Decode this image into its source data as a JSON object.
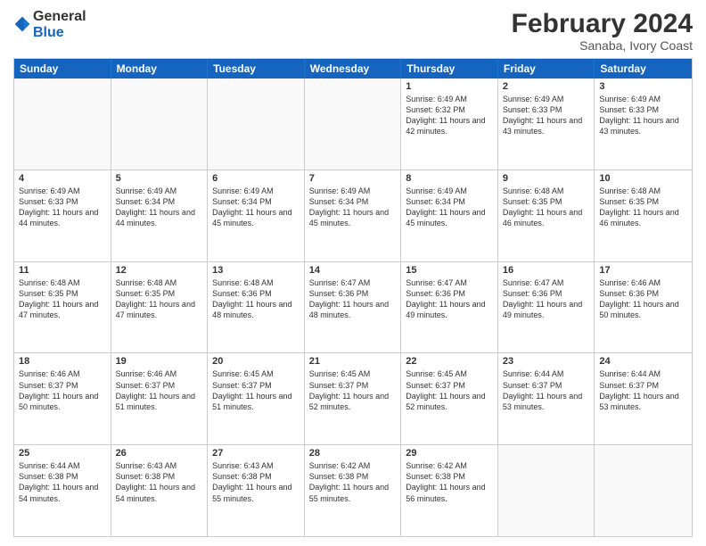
{
  "logo": {
    "general": "General",
    "blue": "Blue"
  },
  "header": {
    "month": "February 2024",
    "location": "Sanaba, Ivory Coast"
  },
  "days": [
    "Sunday",
    "Monday",
    "Tuesday",
    "Wednesday",
    "Thursday",
    "Friday",
    "Saturday"
  ],
  "weeks": [
    [
      {
        "num": "",
        "sunrise": "",
        "sunset": "",
        "daylight": "",
        "empty": true
      },
      {
        "num": "",
        "sunrise": "",
        "sunset": "",
        "daylight": "",
        "empty": true
      },
      {
        "num": "",
        "sunrise": "",
        "sunset": "",
        "daylight": "",
        "empty": true
      },
      {
        "num": "",
        "sunrise": "",
        "sunset": "",
        "daylight": "",
        "empty": true
      },
      {
        "num": "1",
        "sunrise": "Sunrise: 6:49 AM",
        "sunset": "Sunset: 6:32 PM",
        "daylight": "Daylight: 11 hours and 42 minutes.",
        "empty": false
      },
      {
        "num": "2",
        "sunrise": "Sunrise: 6:49 AM",
        "sunset": "Sunset: 6:33 PM",
        "daylight": "Daylight: 11 hours and 43 minutes.",
        "empty": false
      },
      {
        "num": "3",
        "sunrise": "Sunrise: 6:49 AM",
        "sunset": "Sunset: 6:33 PM",
        "daylight": "Daylight: 11 hours and 43 minutes.",
        "empty": false
      }
    ],
    [
      {
        "num": "4",
        "sunrise": "Sunrise: 6:49 AM",
        "sunset": "Sunset: 6:33 PM",
        "daylight": "Daylight: 11 hours and 44 minutes.",
        "empty": false
      },
      {
        "num": "5",
        "sunrise": "Sunrise: 6:49 AM",
        "sunset": "Sunset: 6:34 PM",
        "daylight": "Daylight: 11 hours and 44 minutes.",
        "empty": false
      },
      {
        "num": "6",
        "sunrise": "Sunrise: 6:49 AM",
        "sunset": "Sunset: 6:34 PM",
        "daylight": "Daylight: 11 hours and 45 minutes.",
        "empty": false
      },
      {
        "num": "7",
        "sunrise": "Sunrise: 6:49 AM",
        "sunset": "Sunset: 6:34 PM",
        "daylight": "Daylight: 11 hours and 45 minutes.",
        "empty": false
      },
      {
        "num": "8",
        "sunrise": "Sunrise: 6:49 AM",
        "sunset": "Sunset: 6:34 PM",
        "daylight": "Daylight: 11 hours and 45 minutes.",
        "empty": false
      },
      {
        "num": "9",
        "sunrise": "Sunrise: 6:48 AM",
        "sunset": "Sunset: 6:35 PM",
        "daylight": "Daylight: 11 hours and 46 minutes.",
        "empty": false
      },
      {
        "num": "10",
        "sunrise": "Sunrise: 6:48 AM",
        "sunset": "Sunset: 6:35 PM",
        "daylight": "Daylight: 11 hours and 46 minutes.",
        "empty": false
      }
    ],
    [
      {
        "num": "11",
        "sunrise": "Sunrise: 6:48 AM",
        "sunset": "Sunset: 6:35 PM",
        "daylight": "Daylight: 11 hours and 47 minutes.",
        "empty": false
      },
      {
        "num": "12",
        "sunrise": "Sunrise: 6:48 AM",
        "sunset": "Sunset: 6:35 PM",
        "daylight": "Daylight: 11 hours and 47 minutes.",
        "empty": false
      },
      {
        "num": "13",
        "sunrise": "Sunrise: 6:48 AM",
        "sunset": "Sunset: 6:36 PM",
        "daylight": "Daylight: 11 hours and 48 minutes.",
        "empty": false
      },
      {
        "num": "14",
        "sunrise": "Sunrise: 6:47 AM",
        "sunset": "Sunset: 6:36 PM",
        "daylight": "Daylight: 11 hours and 48 minutes.",
        "empty": false
      },
      {
        "num": "15",
        "sunrise": "Sunrise: 6:47 AM",
        "sunset": "Sunset: 6:36 PM",
        "daylight": "Daylight: 11 hours and 49 minutes.",
        "empty": false
      },
      {
        "num": "16",
        "sunrise": "Sunrise: 6:47 AM",
        "sunset": "Sunset: 6:36 PM",
        "daylight": "Daylight: 11 hours and 49 minutes.",
        "empty": false
      },
      {
        "num": "17",
        "sunrise": "Sunrise: 6:46 AM",
        "sunset": "Sunset: 6:36 PM",
        "daylight": "Daylight: 11 hours and 50 minutes.",
        "empty": false
      }
    ],
    [
      {
        "num": "18",
        "sunrise": "Sunrise: 6:46 AM",
        "sunset": "Sunset: 6:37 PM",
        "daylight": "Daylight: 11 hours and 50 minutes.",
        "empty": false
      },
      {
        "num": "19",
        "sunrise": "Sunrise: 6:46 AM",
        "sunset": "Sunset: 6:37 PM",
        "daylight": "Daylight: 11 hours and 51 minutes.",
        "empty": false
      },
      {
        "num": "20",
        "sunrise": "Sunrise: 6:45 AM",
        "sunset": "Sunset: 6:37 PM",
        "daylight": "Daylight: 11 hours and 51 minutes.",
        "empty": false
      },
      {
        "num": "21",
        "sunrise": "Sunrise: 6:45 AM",
        "sunset": "Sunset: 6:37 PM",
        "daylight": "Daylight: 11 hours and 52 minutes.",
        "empty": false
      },
      {
        "num": "22",
        "sunrise": "Sunrise: 6:45 AM",
        "sunset": "Sunset: 6:37 PM",
        "daylight": "Daylight: 11 hours and 52 minutes.",
        "empty": false
      },
      {
        "num": "23",
        "sunrise": "Sunrise: 6:44 AM",
        "sunset": "Sunset: 6:37 PM",
        "daylight": "Daylight: 11 hours and 53 minutes.",
        "empty": false
      },
      {
        "num": "24",
        "sunrise": "Sunrise: 6:44 AM",
        "sunset": "Sunset: 6:37 PM",
        "daylight": "Daylight: 11 hours and 53 minutes.",
        "empty": false
      }
    ],
    [
      {
        "num": "25",
        "sunrise": "Sunrise: 6:44 AM",
        "sunset": "Sunset: 6:38 PM",
        "daylight": "Daylight: 11 hours and 54 minutes.",
        "empty": false
      },
      {
        "num": "26",
        "sunrise": "Sunrise: 6:43 AM",
        "sunset": "Sunset: 6:38 PM",
        "daylight": "Daylight: 11 hours and 54 minutes.",
        "empty": false
      },
      {
        "num": "27",
        "sunrise": "Sunrise: 6:43 AM",
        "sunset": "Sunset: 6:38 PM",
        "daylight": "Daylight: 11 hours and 55 minutes.",
        "empty": false
      },
      {
        "num": "28",
        "sunrise": "Sunrise: 6:42 AM",
        "sunset": "Sunset: 6:38 PM",
        "daylight": "Daylight: 11 hours and 55 minutes.",
        "empty": false
      },
      {
        "num": "29",
        "sunrise": "Sunrise: 6:42 AM",
        "sunset": "Sunset: 6:38 PM",
        "daylight": "Daylight: 11 hours and 56 minutes.",
        "empty": false
      },
      {
        "num": "",
        "sunrise": "",
        "sunset": "",
        "daylight": "",
        "empty": true
      },
      {
        "num": "",
        "sunrise": "",
        "sunset": "",
        "daylight": "",
        "empty": true
      }
    ]
  ]
}
